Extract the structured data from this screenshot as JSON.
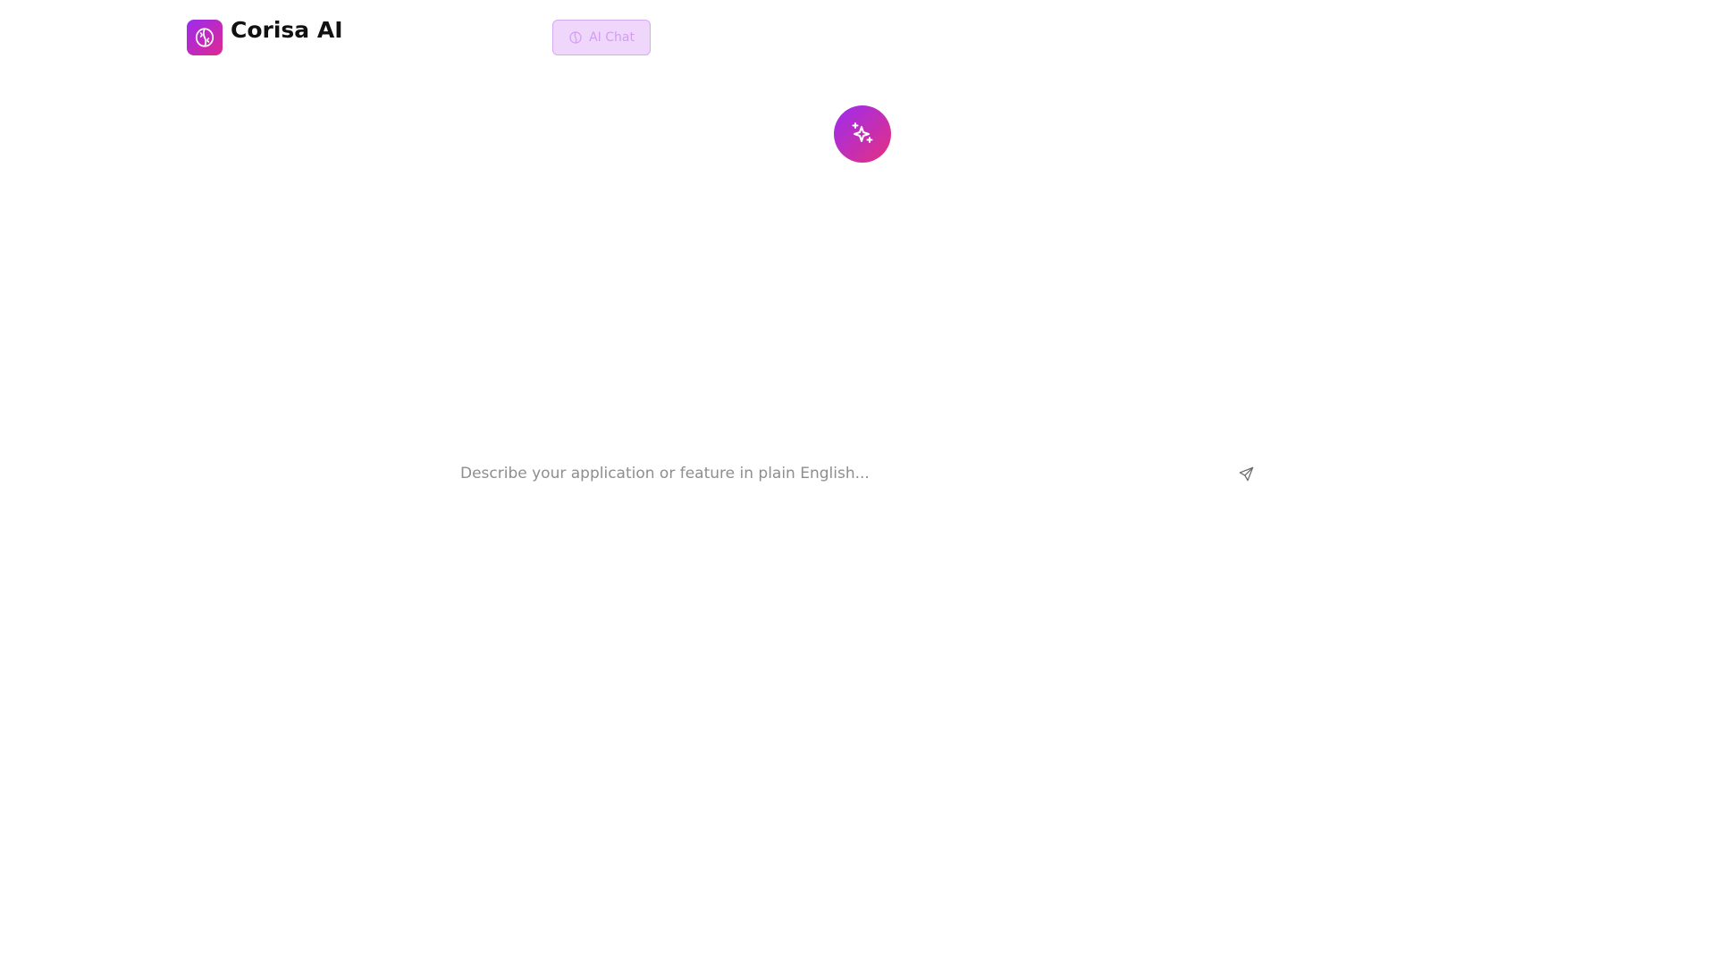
{
  "app": {
    "name": "Corisa AI",
    "logo_icon": "brain-icon",
    "accent_gradient": [
      "#9b2cf0",
      "#e0288f"
    ]
  },
  "nav": {
    "active_tab": {
      "label": "AI Chat",
      "icon": "brain-icon"
    }
  },
  "hero": {
    "icon": "sparkles-icon"
  },
  "prompt": {
    "value": "",
    "placeholder": "Describe your application or feature in plain English...",
    "send_icon": "send-icon"
  }
}
